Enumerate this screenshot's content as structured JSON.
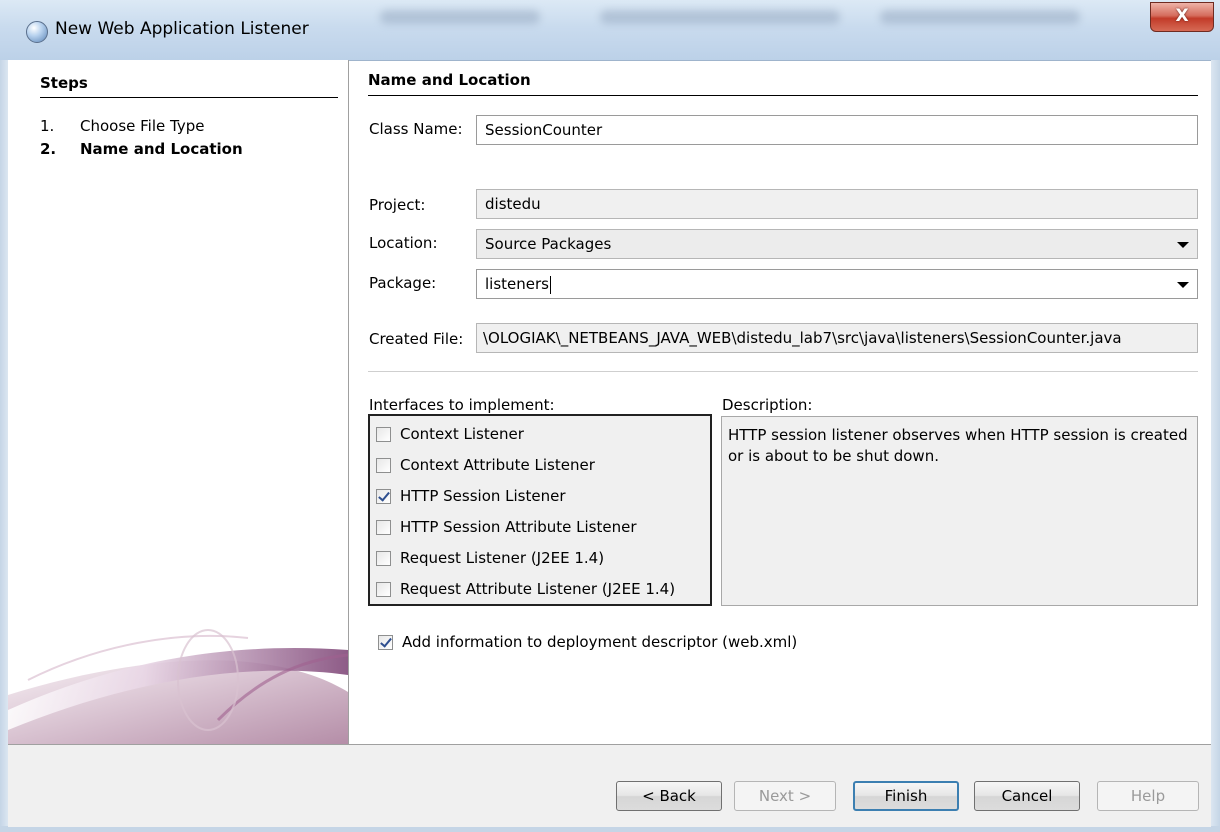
{
  "window": {
    "title": "New Web Application Listener",
    "close_symbol": "X"
  },
  "steps": {
    "title": "Steps",
    "items": [
      {
        "num": "1.",
        "label": "Choose File Type",
        "active": false
      },
      {
        "num": "2.",
        "label": "Name and Location",
        "active": true
      }
    ]
  },
  "form": {
    "section_title": "Name and Location",
    "class_name": {
      "label": "Class Name:",
      "value": "SessionCounter"
    },
    "project": {
      "label": "Project:",
      "value": "distedu"
    },
    "location": {
      "label": "Location:",
      "value": "Source Packages"
    },
    "package": {
      "label": "Package:",
      "value": "listeners"
    },
    "created_file": {
      "label": "Created File:",
      "value": "\\OLOGIAK\\_NETBEANS_JAVA_WEB\\distedu_lab7\\src\\java\\listeners\\SessionCounter.java"
    }
  },
  "interfaces": {
    "label": "Interfaces to implement:",
    "items": [
      {
        "label": "Context Listener",
        "checked": false
      },
      {
        "label": "Context Attribute Listener",
        "checked": false
      },
      {
        "label": "HTTP Session Listener",
        "checked": true
      },
      {
        "label": "HTTP Session Attribute Listener",
        "checked": false
      },
      {
        "label": "Request Listener (J2EE 1.4)",
        "checked": false
      },
      {
        "label": "Request Attribute Listener (J2EE 1.4)",
        "checked": false
      }
    ]
  },
  "description": {
    "label": "Description:",
    "text": "HTTP session listener observes when HTTP session is created or is about to be shut down."
  },
  "deployment": {
    "label": "Add information to deployment descriptor (web.xml)",
    "checked": true
  },
  "buttons": {
    "back": "< Back",
    "next": "Next >",
    "finish": "Finish",
    "cancel": "Cancel",
    "help": "Help"
  },
  "colors": {
    "titlebar": "#c9dbee",
    "close": "#c23b29",
    "default_button_border": "#3c7fb1"
  },
  "icons": {
    "app": "netbeans-cube-icon",
    "combo_arrow": "chevron-down-icon",
    "checkbox_mark": "check-icon"
  }
}
